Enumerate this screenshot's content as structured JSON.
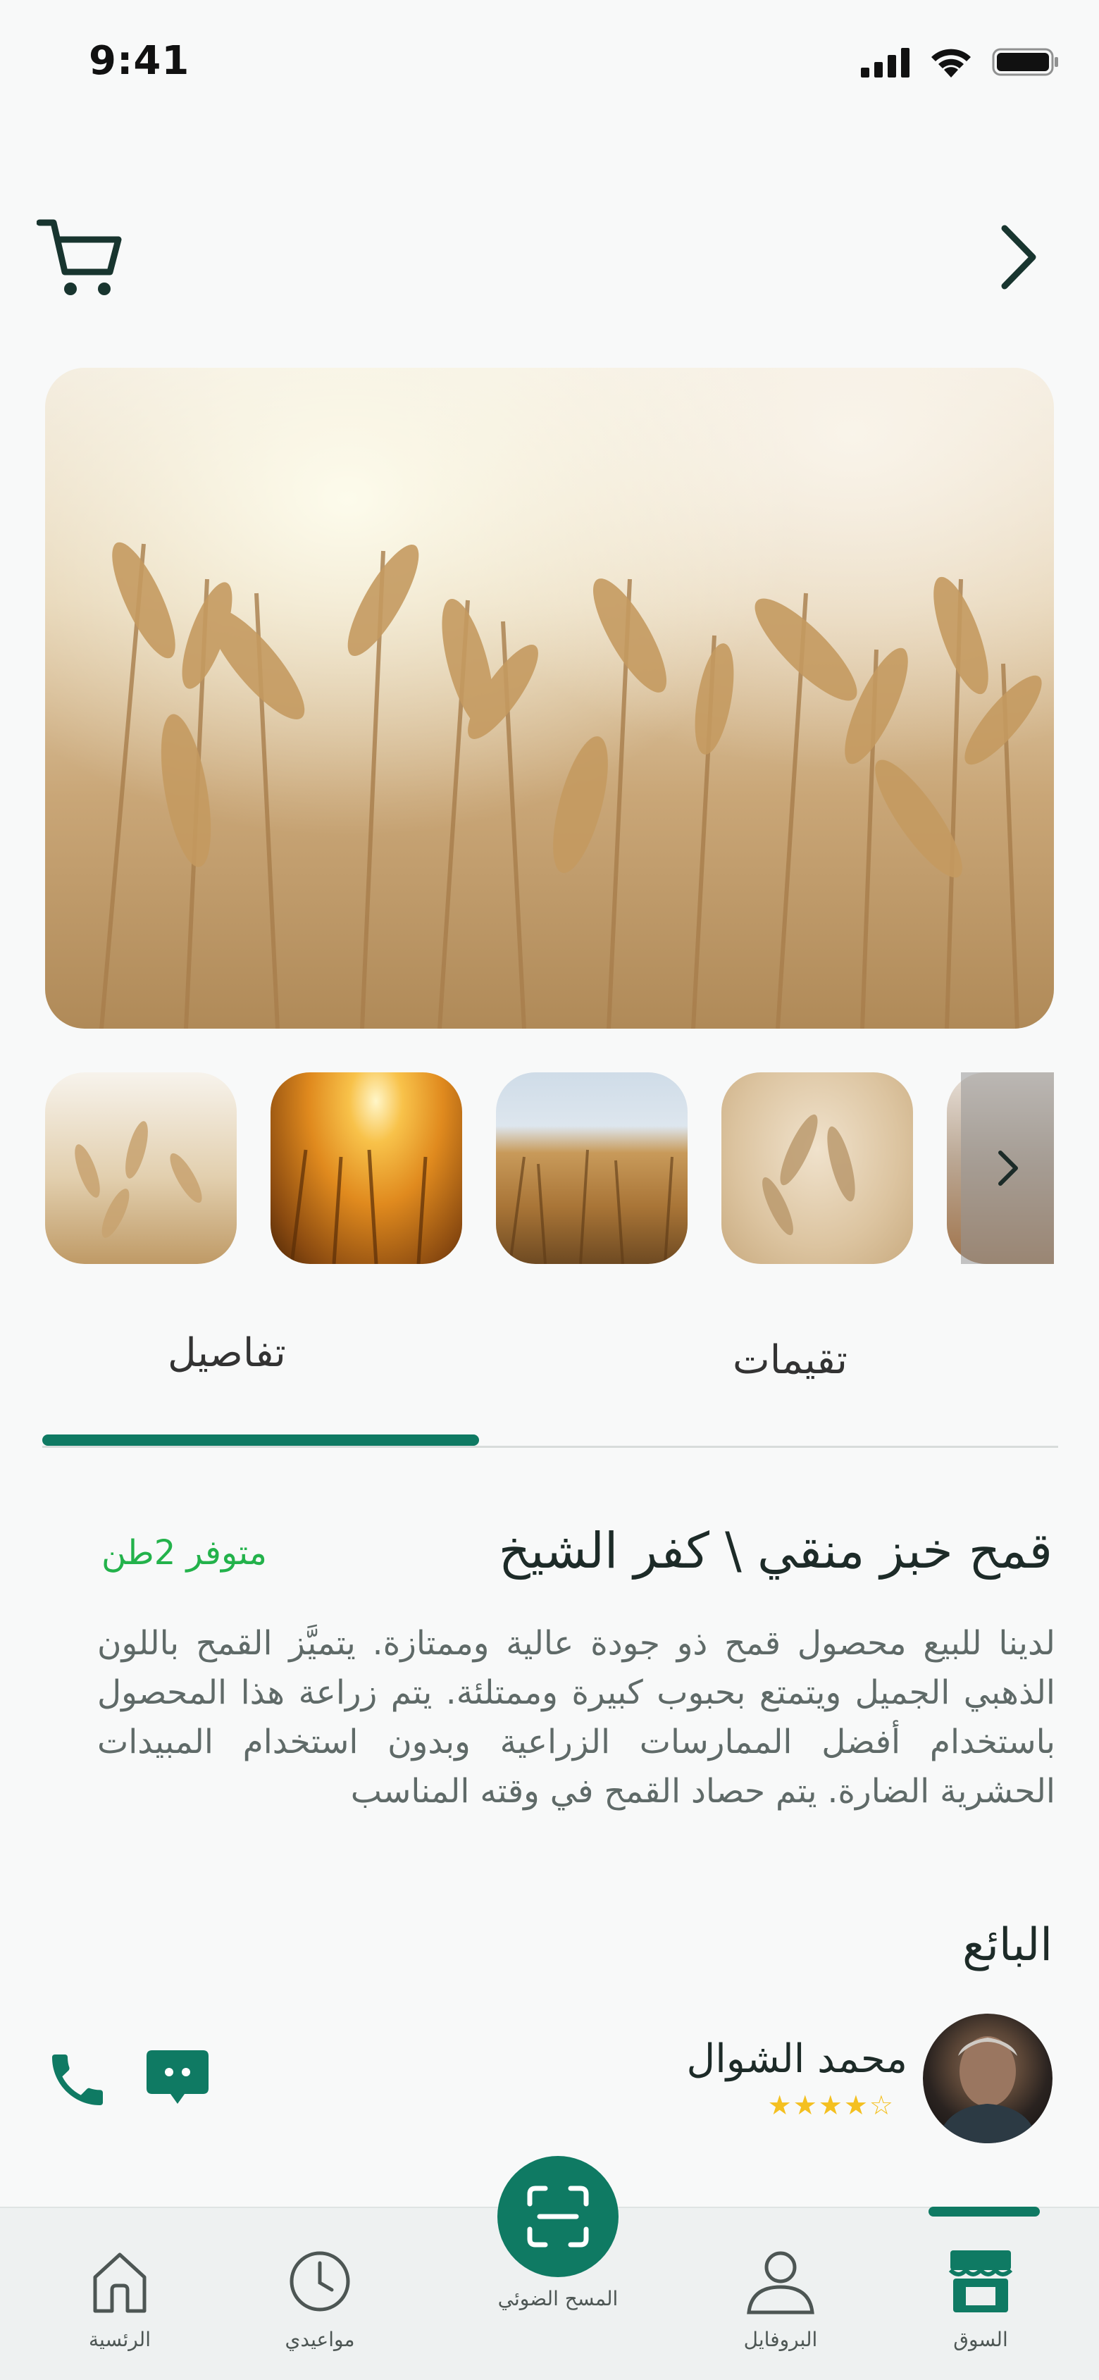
{
  "status_bar": {
    "time": "9:41"
  },
  "header": {
    "cart_icon": "cart-icon",
    "back_icon": "chevron-right-icon"
  },
  "gallery": {
    "main_image": "wheat-field-photo",
    "thumbnails": [
      "wheat-closeup",
      "wheat-sunset",
      "wheat-field-sky",
      "wheat-stalks-soft",
      "wheat-field-hills"
    ]
  },
  "tabs": {
    "details": "تفاصيل",
    "ratings": "تقيمات",
    "active": "details"
  },
  "product": {
    "title": "قمح خبز منقي \\ كفر الشيخ",
    "availability": "متوفر 2طن",
    "description": "لدينا للبيع محصول قمح ذو جودة عالية وممتازة. يتميَّز القمح باللون الذهبي الجميل ويتمتع بحبوب كبيرة وممتلئة. يتم زراعة هذا المحصول باستخدام أفضل الممارسات الزراعية وبدون استخدام المبيدات الحشرية الضارة. يتم حصاد القمح في وقته المناسب"
  },
  "seller": {
    "heading": "البائع",
    "name": "محمد الشوال",
    "rating": 4,
    "rating_max": 5,
    "stars_text": "★★★★☆"
  },
  "colors": {
    "accent": "#0f7a63",
    "available": "#23b24b",
    "star": "#f4c020"
  },
  "nav": {
    "market": "السوق",
    "profile": "البروفايل",
    "scan": "المسح الضوئي",
    "appointments": "مواعيدي",
    "home": "الرئسية",
    "active": "market"
  }
}
